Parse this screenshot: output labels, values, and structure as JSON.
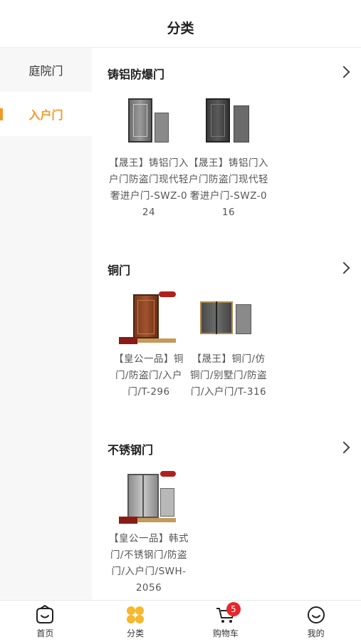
{
  "header": {
    "title": "分类"
  },
  "sidebar": {
    "items": [
      {
        "label": "庭院门",
        "active": false
      },
      {
        "label": "入户门",
        "active": true
      }
    ]
  },
  "sections": [
    {
      "title": "铸铝防爆门",
      "products": [
        {
          "name": "【晟王】铸铝门入户门防盗门现代轻奢进户门-SWZ-024"
        },
        {
          "name": "【晟王】铸铝门入户门防盗门现代轻奢进户门-SWZ-016"
        }
      ]
    },
    {
      "title": "铜门",
      "products": [
        {
          "name": "【皇公一品】铜门/防盗门/入户门/T-296"
        },
        {
          "name": "【晟王】铜门/仿铜门/别墅门/防盗门/入户门/T-316"
        }
      ]
    },
    {
      "title": "不锈钢门",
      "products": [
        {
          "name": "【皇公一品】韩式门/不锈钢门/防盗门/入户门/SWH-2056"
        }
      ]
    }
  ],
  "tabbar": {
    "items": [
      {
        "label": "首页",
        "icon": "home-icon"
      },
      {
        "label": "分类",
        "icon": "category-icon"
      },
      {
        "label": "购物车",
        "icon": "cart-icon",
        "badge": "5"
      },
      {
        "label": "我的",
        "icon": "profile-icon"
      }
    ]
  },
  "colors": {
    "accent": "#f29a26",
    "badge": "#e8262c"
  }
}
